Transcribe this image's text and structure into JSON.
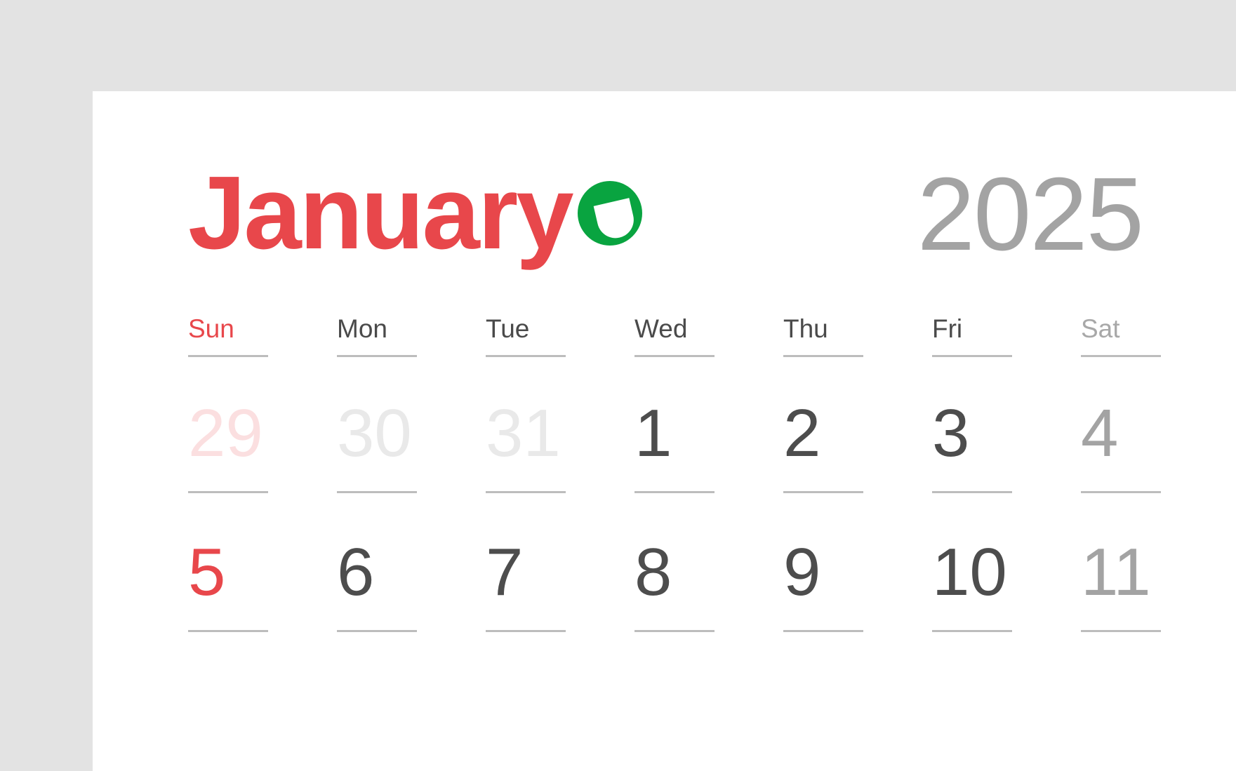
{
  "page": {
    "background_color": "#e3e3e3",
    "card_color": "#ffffff"
  },
  "header": {
    "month": "January",
    "year": "2025",
    "month_color": "#e8474b",
    "year_color": "#a3a3a3",
    "logo": {
      "icon": "green-circle-logo-icon",
      "circle_color": "#09a440",
      "glyph_color": "#ffffff"
    }
  },
  "weekdays": [
    {
      "label": "Sun",
      "kind": "sunday",
      "color": "#e8474b"
    },
    {
      "label": "Mon",
      "kind": "weekday",
      "color": "#4a4a4a"
    },
    {
      "label": "Tue",
      "kind": "weekday",
      "color": "#4a4a4a"
    },
    {
      "label": "Wed",
      "kind": "weekday",
      "color": "#4a4a4a"
    },
    {
      "label": "Thu",
      "kind": "weekday",
      "color": "#4a4a4a"
    },
    {
      "label": "Fri",
      "kind": "weekday",
      "color": "#4a4a4a"
    },
    {
      "label": "Sat",
      "kind": "saturday",
      "color": "#a8a8a8"
    }
  ],
  "weeks": [
    {
      "days": [
        {
          "number": "29",
          "kind": "sunday",
          "outside_month": true
        },
        {
          "number": "30",
          "kind": "weekday",
          "outside_month": true
        },
        {
          "number": "31",
          "kind": "weekday",
          "outside_month": true
        },
        {
          "number": "1",
          "kind": "weekday",
          "outside_month": false
        },
        {
          "number": "2",
          "kind": "weekday",
          "outside_month": false
        },
        {
          "number": "3",
          "kind": "weekday",
          "outside_month": false
        },
        {
          "number": "4",
          "kind": "saturday",
          "outside_month": false
        }
      ]
    },
    {
      "days": [
        {
          "number": "5",
          "kind": "sunday",
          "outside_month": false
        },
        {
          "number": "6",
          "kind": "weekday",
          "outside_month": false
        },
        {
          "number": "7",
          "kind": "weekday",
          "outside_month": false
        },
        {
          "number": "8",
          "kind": "weekday",
          "outside_month": false
        },
        {
          "number": "9",
          "kind": "weekday",
          "outside_month": false
        },
        {
          "number": "10",
          "kind": "weekday",
          "outside_month": false
        },
        {
          "number": "11",
          "kind": "saturday",
          "outside_month": false
        }
      ]
    }
  ],
  "layout": {
    "column_pitch": 212,
    "rule_color": "#bdbdbd"
  }
}
